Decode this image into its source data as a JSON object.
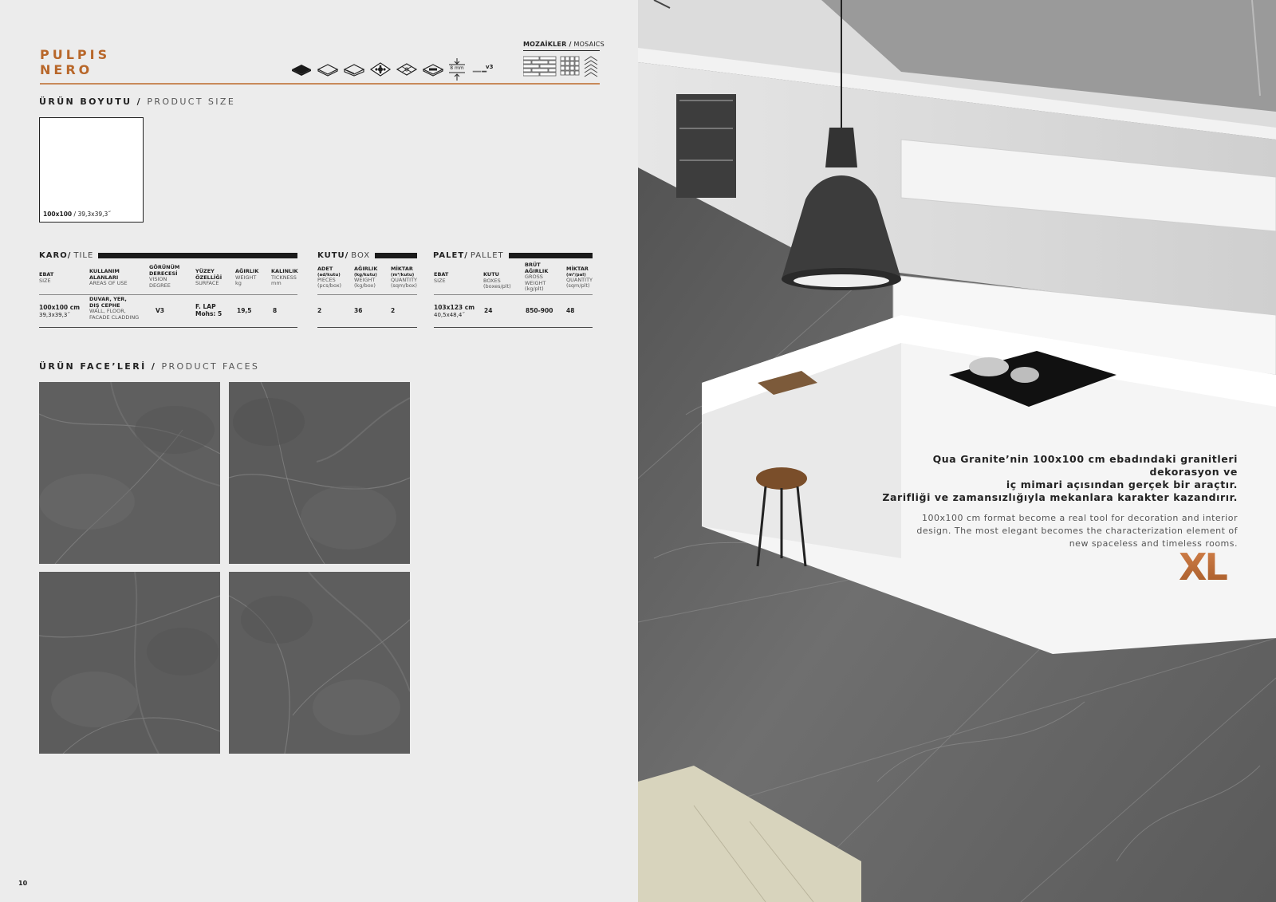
{
  "product": {
    "line1": "PULPIS",
    "line2": "NERO"
  },
  "mosaics": {
    "label_tr": "MOZAİKLER",
    "label_en": "MOSAICS"
  },
  "icons": [
    "full-body-tile-icon",
    "tile-outline-icon",
    "tile-edge-icon",
    "decor-pattern-icon",
    "grid-pattern-icon",
    "tile-text-icon",
    "thickness-8mm-icon",
    "variation-v3-icon"
  ],
  "icon_texts": {
    "thickness": "8 mm",
    "variation": "v3"
  },
  "size_section": {
    "title_tr": "ÜRÜN BOYUTU",
    "sep": " / ",
    "title_en": "PRODUCT SIZE",
    "size_cm": "100x100",
    "size_in": "/ 39,3x39,3˝"
  },
  "tile_table": {
    "title_tr": "KARO",
    "title_en": "TILE",
    "headers": [
      {
        "tr": "EBAT",
        "en": "SIZE"
      },
      {
        "tr": "KULLANIM\nALANLARI",
        "en": "AREAS OF USE"
      },
      {
        "tr": "GÖRÜNÜM\nDERECESİ",
        "en": "VISION\nDEGREE"
      },
      {
        "tr": "YÜZEY\nÖZELLİĞİ",
        "en": "SURFACE"
      },
      {
        "tr": "AĞIRLIK",
        "en": "WEIGHT\nkg"
      },
      {
        "tr": "KALINLIK",
        "en": "TICKNESS\nmm"
      }
    ],
    "row": {
      "size_cm": "100x100 cm",
      "size_in": "39,3x39,3˝",
      "use_tr": "DUVAR, YER,\nDIŞ CEPHE",
      "use_en": "WALL, FLOOR,\nFACADE CLADDING",
      "vision": "V3",
      "surface": "F. LAP\nMohs: 5",
      "weight": "19,5",
      "thickness": "8"
    }
  },
  "box_table": {
    "title_tr": "KUTU",
    "title_en": "BOX",
    "headers": [
      {
        "tr": "ADET",
        "sub": "(ad/kutu)",
        "en": "PIECES\n(pcs/box)"
      },
      {
        "tr": "AĞIRLIK",
        "sub": "(kg/kutu)",
        "en": "WEIGHT\n(kg/box)"
      },
      {
        "tr": "MİKTAR",
        "sub": "(m²/kutu)",
        "en": "QUANTITY\n(sqm/box)"
      }
    ],
    "row": {
      "pieces": "2",
      "weight": "36",
      "quantity": "2"
    }
  },
  "pallet_table": {
    "title_tr": "PALET",
    "title_en": "PALLET",
    "headers": [
      {
        "tr": "EBAT",
        "en": "SIZE"
      },
      {
        "tr": "KUTU",
        "en": "BOXES\n(boxes/plt)"
      },
      {
        "tr": "BRÜT\nAĞIRLIK",
        "en": "GROSS\nWEIGHT\n(kg/plt)"
      },
      {
        "tr": "MİKTAR",
        "sub": "(m²/pal)",
        "en": "QUANTITY\n(sqm/plt)"
      }
    ],
    "row": {
      "size_cm": "103x123 cm",
      "size_in": "40,5x48,4˝",
      "boxes": "24",
      "gross": "850-900",
      "quantity": "48"
    }
  },
  "faces_section": {
    "title_tr": "ÜRÜN FACE’LERİ",
    "sep": " / ",
    "title_en": "PRODUCT FACES"
  },
  "faces": [
    "face-1",
    "face-2",
    "face-3",
    "face-4"
  ],
  "page_number": "10",
  "caption": {
    "tr": "Qua Granite’nin 100x100 cm ebadındaki granitleri dekorasyon ve\niç mimari açısından gerçek bir araçtır.\nZarifliği ve zamansızlığıyla mekanlara karakter kazandırır.",
    "en": "100x100 cm format become a real tool for decoration and interior\ndesign. The most elegant becomes the characterization element of\nnew spaceless and timeless rooms."
  },
  "badge": "XL",
  "colors": {
    "accent": "#b8672a",
    "rule": "#c88a5a",
    "marble": "#5d5d5d",
    "paper": "#ececec"
  }
}
